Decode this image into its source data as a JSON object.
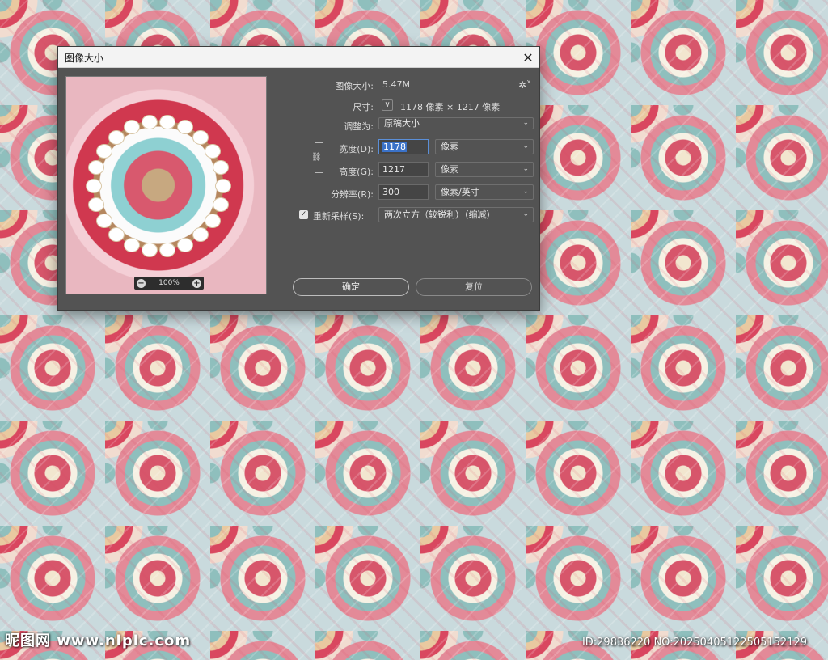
{
  "dialog": {
    "title": "图像大小",
    "close_glyph": "✕"
  },
  "preview": {
    "zoom_level": "100%",
    "zoom_out": "−",
    "zoom_in": "+"
  },
  "form": {
    "image_size_label": "图像大小:",
    "image_size_value": "5.47M",
    "settings_glyph": "✲˅",
    "dimensions_label": "尺寸:",
    "dimensions_toggle_glyph": "∨",
    "dimensions_value": "1178 像素 × 1217 像素",
    "fit_to_label": "调整为:",
    "fit_to_value": "原稿大小",
    "width_label": "宽度(D):",
    "width_value": "1178",
    "width_unit": "像素",
    "height_label": "高度(G):",
    "height_value": "1217",
    "height_unit": "像素",
    "resolution_label": "分辨率(R):",
    "resolution_value": "300",
    "resolution_unit": "像素/英寸",
    "resample_label": "重新采样(S):",
    "resample_checked": "✓",
    "resample_value": "两次立方（较锐利）（缩减）",
    "link_glyph": "⛓",
    "chevron": "⌄"
  },
  "buttons": {
    "ok": "确定",
    "reset": "复位"
  },
  "watermark": {
    "left": "昵图网 www.nipic.com",
    "right": "ID:29836220 NO:20250405122505152129"
  }
}
